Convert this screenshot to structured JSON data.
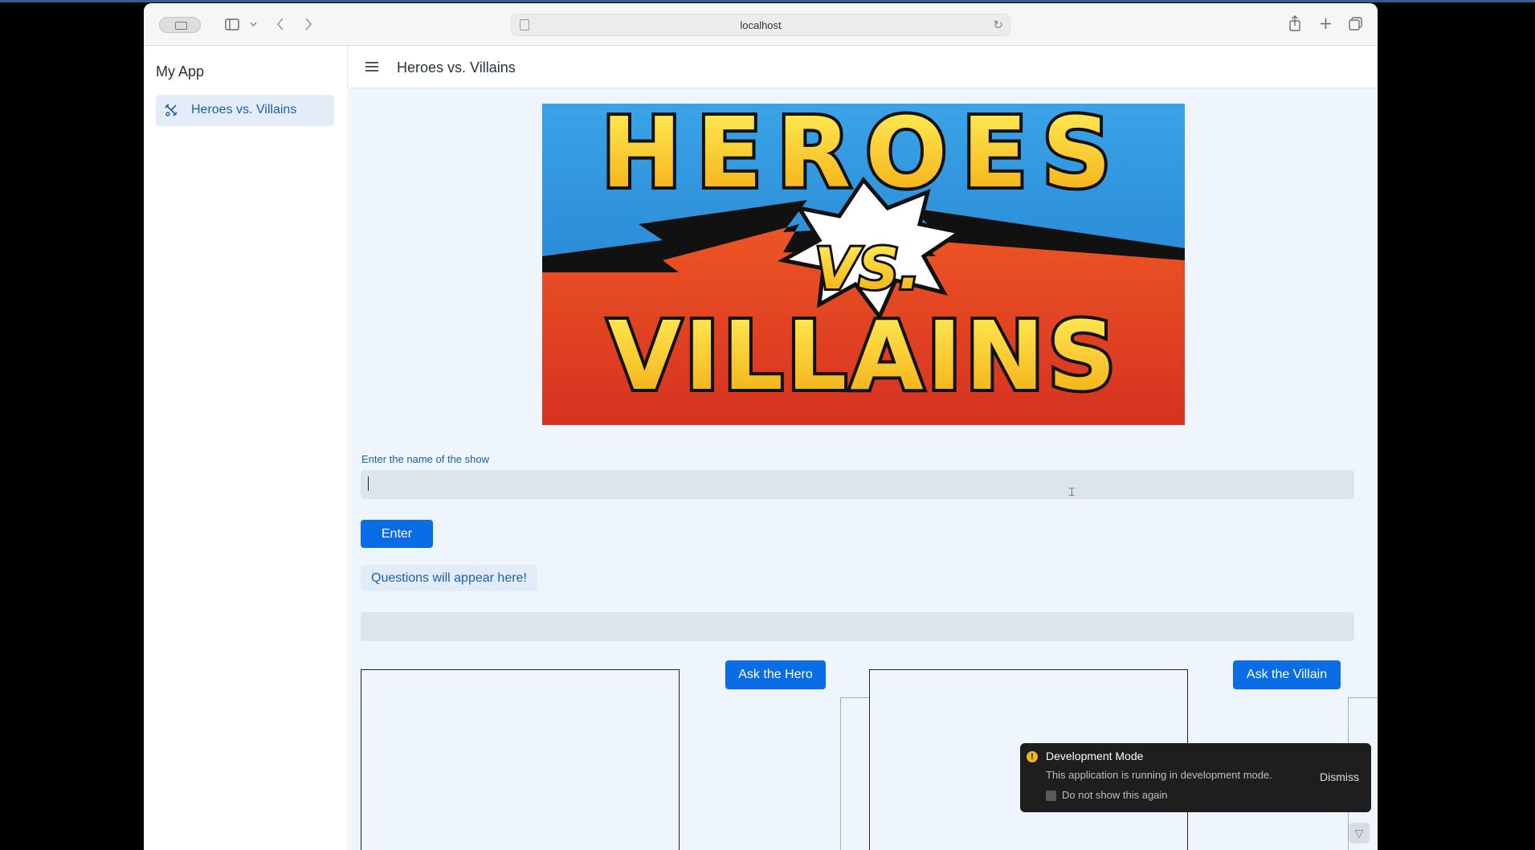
{
  "browser": {
    "url": "localhost",
    "icons": [
      "sidebar-toggle-icon",
      "chevron-down-icon",
      "back-icon",
      "forward-icon",
      "reload-icon",
      "share-icon",
      "new-tab-icon",
      "tabs-overview-icon"
    ]
  },
  "sidebar": {
    "app_title": "My App",
    "items": [
      {
        "label": "Heroes vs. Villains",
        "icon": "tools-icon",
        "active": true
      }
    ]
  },
  "header": {
    "title": "Heroes vs. Villains"
  },
  "banner": {
    "line1": "HEROES",
    "line2": "VS.",
    "line3": "VILLAINS"
  },
  "form": {
    "label": "Enter the name of the show",
    "value": "",
    "enter_label": "Enter"
  },
  "questions": {
    "placeholder": "Questions will appear here!"
  },
  "panels": {
    "ask_hero_label": "Ask the Hero",
    "ask_villain_label": "Ask the Villain"
  },
  "toast": {
    "title": "Development Mode",
    "body": "This application is running in development mode.",
    "dismiss": "Dismiss",
    "checkbox_label": "Do not show this again"
  },
  "colors": {
    "accent": "#0b6de5",
    "nav_active_bg": "#e4ecf8",
    "main_bg": "#eef5fd",
    "toast_bg": "#1e1e1e"
  }
}
